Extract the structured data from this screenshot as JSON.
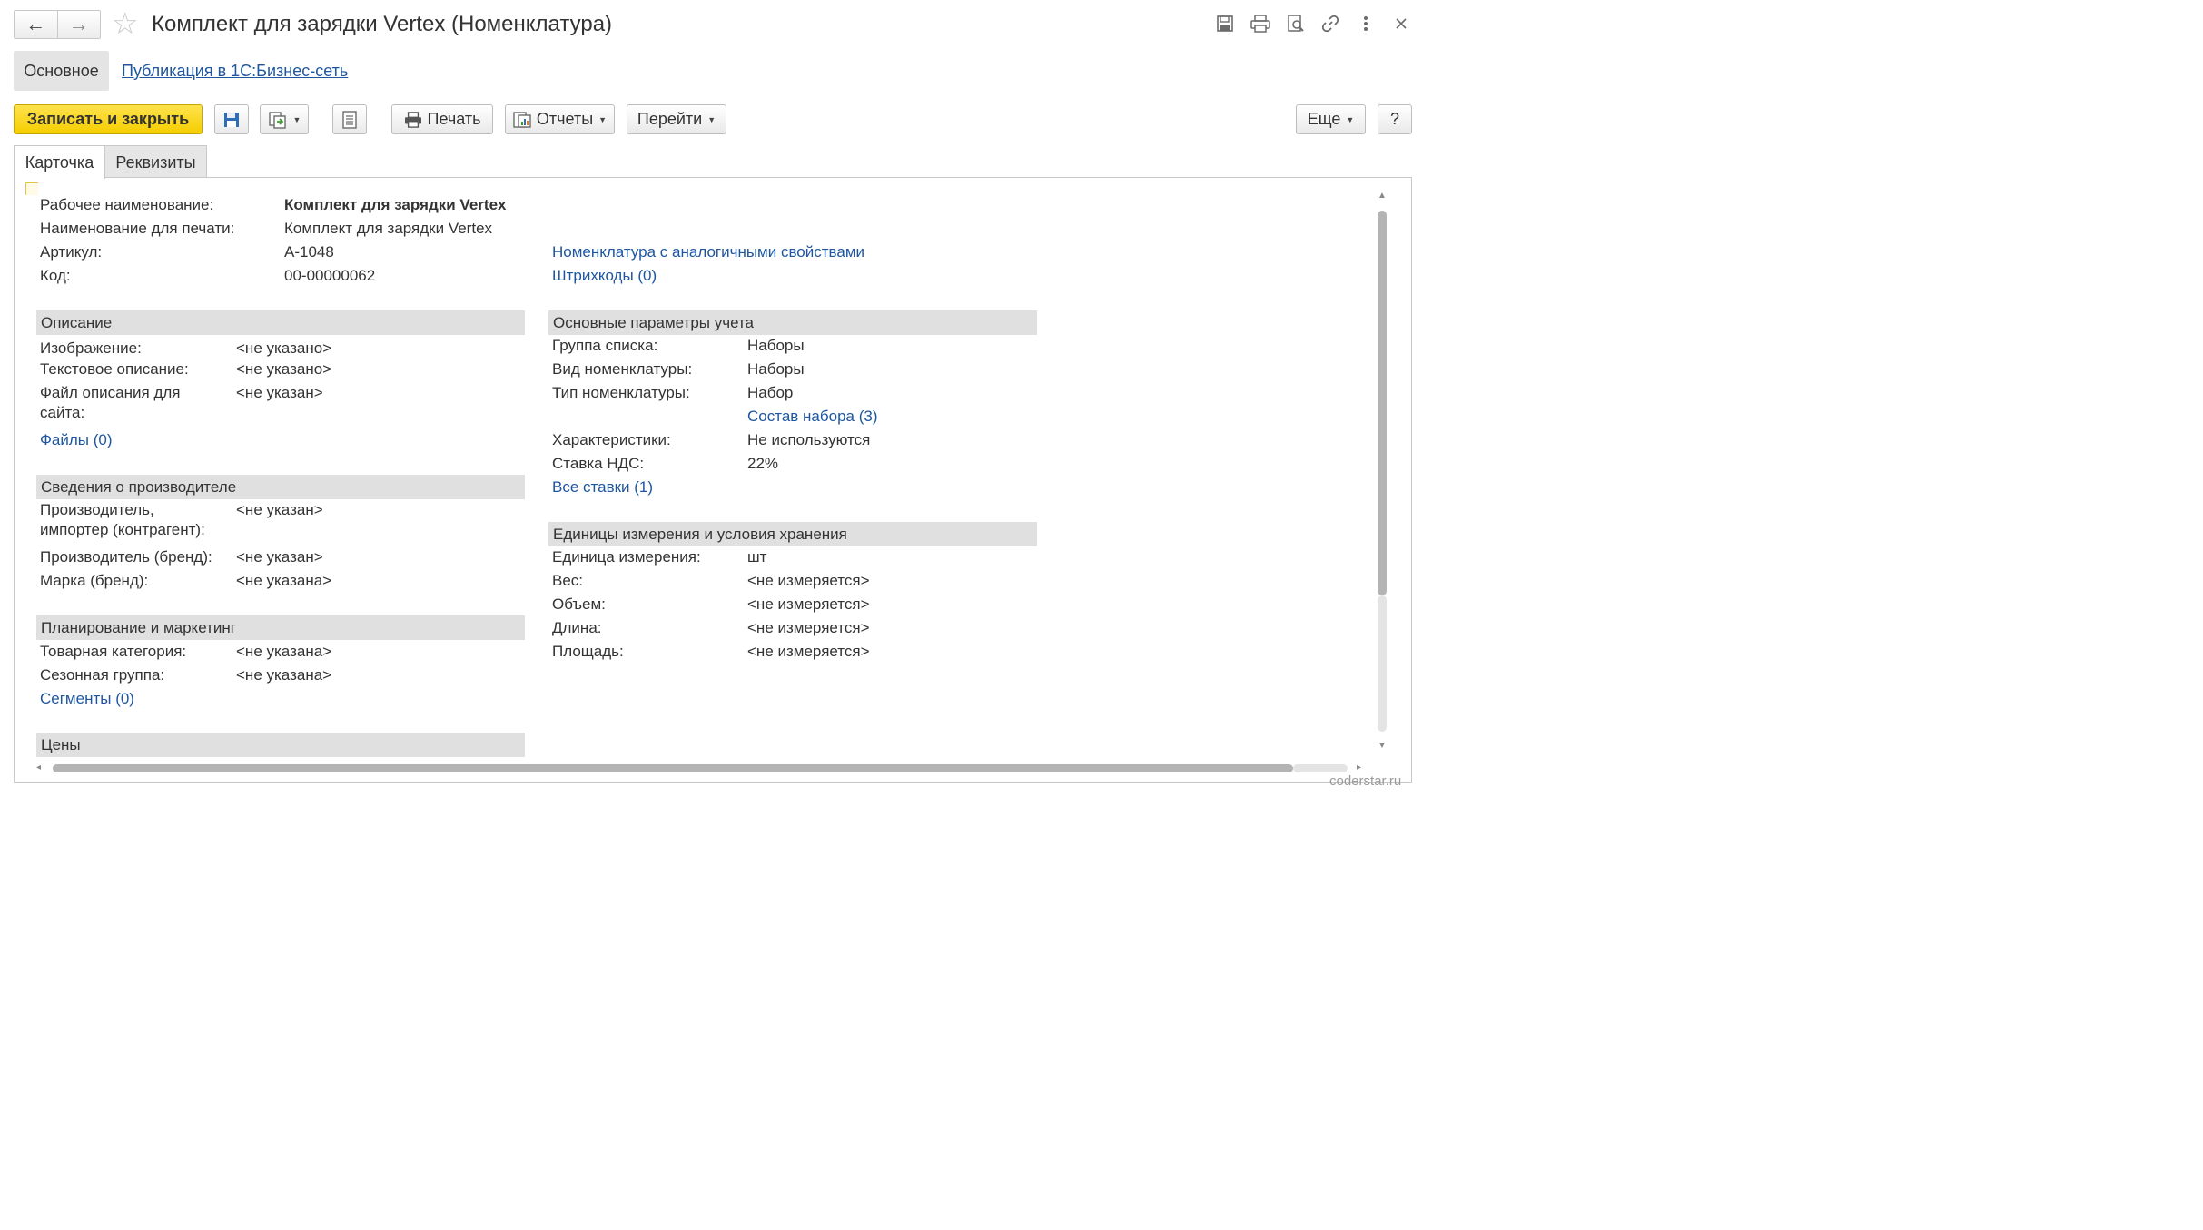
{
  "header": {
    "back_icon": "←",
    "forward_icon": "→",
    "title": "Комплект для зарядки Vertex (Номенклатура)"
  },
  "section_nav": {
    "active": "Основное",
    "link": "Публикация в 1С:Бизнес-сеть"
  },
  "toolbar": {
    "save_close": "Записать и закрыть",
    "print": "Печать",
    "reports": "Отчеты",
    "goto": "Перейти",
    "more": "Еще",
    "help": "?"
  },
  "tabs": [
    "Карточка",
    "Реквизиты"
  ],
  "main": {
    "fields": [
      {
        "label": "Рабочее наименование:",
        "value": "Комплект для зарядки Vertex"
      },
      {
        "label": "Наименование для печати:",
        "value": "Комплект для зарядки Vertex"
      },
      {
        "label": "Артикул:",
        "value": "А-1048"
      },
      {
        "label": "Код:",
        "value": "00-00000062"
      }
    ],
    "links": [
      "Номенклатура с аналогичными свойствами",
      "Штрихкоды (0)"
    ]
  },
  "description": {
    "title": "Описание",
    "rows": [
      {
        "label": "Изображение:",
        "value": "<не указано>"
      },
      {
        "label": "Текстовое описание:",
        "value": "<не указано>"
      },
      {
        "label": "Файл описания для",
        "label2": "сайта:",
        "value": "<не указан>"
      }
    ],
    "link": "Файлы (0)"
  },
  "manufacturer": {
    "title": "Сведения о производителе",
    "rows": [
      {
        "label": "Производитель,",
        "label2": "импортер (контрагент):",
        "value": "<не указан>"
      },
      {
        "label": "Производитель (бренд):",
        "value": "<не указан>"
      },
      {
        "label": "Марка (бренд):",
        "value": "<не указана>"
      }
    ]
  },
  "planning": {
    "title": "Планирование и маркетинг",
    "rows": [
      {
        "label": "Товарная категория:",
        "value": "<не указана>"
      },
      {
        "label": "Сезонная группа:",
        "value": "<не указана>"
      }
    ],
    "link": "Сегменты (0)"
  },
  "prices": {
    "title": "Цены"
  },
  "accounting": {
    "title": "Основные параметры учета",
    "rows": [
      {
        "label": "Группа списка:",
        "value": "Наборы"
      },
      {
        "label": "Вид номенклатуры:",
        "value": "Наборы"
      },
      {
        "label": "Тип номенклатуры:",
        "value": "Набор"
      }
    ],
    "set_link": "Состав набора (3)",
    "rows2": [
      {
        "label": "Характеристики:",
        "value": "Не используются"
      },
      {
        "label": "Ставка НДС:",
        "value": "22%"
      }
    ],
    "link": "Все ставки (1)"
  },
  "units": {
    "title": "Единицы измерения и условия хранения",
    "rows": [
      {
        "label": "Единица измерения:",
        "value": "шт"
      },
      {
        "label": "Вес:",
        "value": "<не измеряется>"
      },
      {
        "label": "Объем:",
        "value": "<не измеряется>"
      },
      {
        "label": "Длина:",
        "value": "<не измеряется>"
      },
      {
        "label": "Площадь:",
        "value": "<не измеряется>"
      }
    ]
  },
  "watermark": "coderstar.ru",
  "colors": {
    "accent": "#f5ce00",
    "link": "#1e56a0",
    "group_bg": "#e0e0e0"
  }
}
